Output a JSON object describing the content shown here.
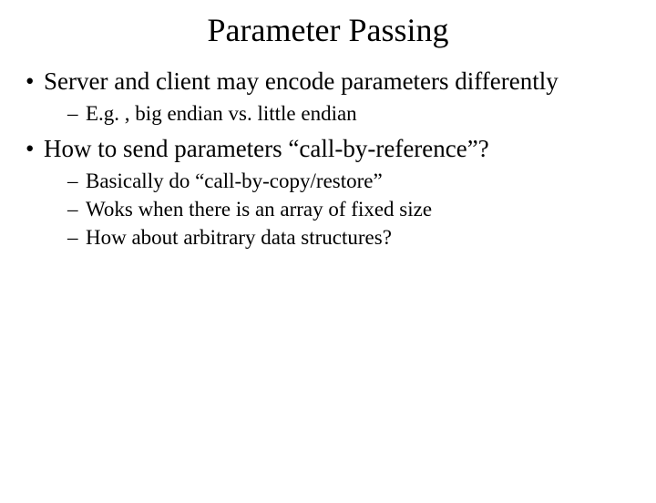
{
  "title": "Parameter Passing",
  "bullets": [
    {
      "text": "Server and client may encode parameters differently",
      "sub": [
        "E.g. , big endian vs. little endian"
      ]
    },
    {
      "text": "How to send parameters “call-by-reference”?",
      "sub": [
        "Basically do “call-by-copy/restore”",
        "Woks when there is an array of fixed size",
        "How about arbitrary data structures?"
      ]
    }
  ]
}
